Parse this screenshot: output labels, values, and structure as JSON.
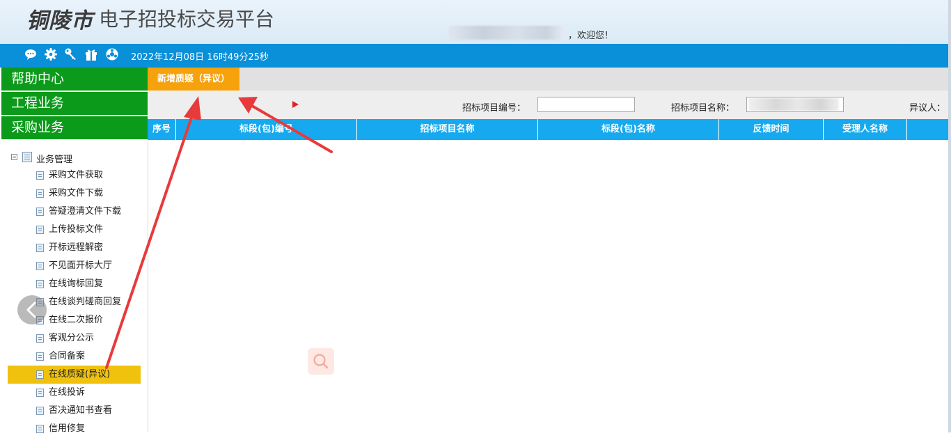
{
  "header": {
    "city": "铜陵市",
    "platform": "电子招投标交易平台",
    "welcome": "，欢迎您！"
  },
  "toolbar": {
    "icons": [
      "chat-icon",
      "gear-icon",
      "key-icon",
      "gift-icon",
      "settings-wheel-icon"
    ],
    "datetime": "2022年12月08日 16时49分25秒"
  },
  "sidebar": {
    "menus": [
      "帮助中心",
      "工程业务",
      "采购业务"
    ],
    "tree_root": "业务管理",
    "tree_items": [
      "采购文件获取",
      "采购文件下载",
      "答疑澄清文件下载",
      "上传投标文件",
      "开标远程解密",
      "不见面开标大厅",
      "在线询标回复",
      "在线谈判磋商回复",
      "在线二次报价",
      "客观分公示",
      "合同备案",
      "在线质疑(异议)",
      "在线投诉",
      "否决通知书查看",
      "信用修复"
    ],
    "active_item": "在线质疑(异议)"
  },
  "main": {
    "tab_label": "新增质疑（异议）",
    "filters": {
      "project_no_label": "招标项目编号：",
      "project_no_value": "",
      "project_name_label": "招标项目名称：",
      "objector_label": "异议人："
    },
    "columns": [
      "序号",
      "标段(包)编号",
      "招标项目名称",
      "标段(包)名称",
      "反馈时间",
      "受理人名称",
      ""
    ]
  },
  "colors": {
    "toolbar": "#0a8fd9",
    "nav_green": "#0b9a1a",
    "tab_active": "#f5a20c",
    "table_head": "#16a9ef",
    "highlight": "#f0c20e",
    "arrow": "#e83a3a"
  }
}
